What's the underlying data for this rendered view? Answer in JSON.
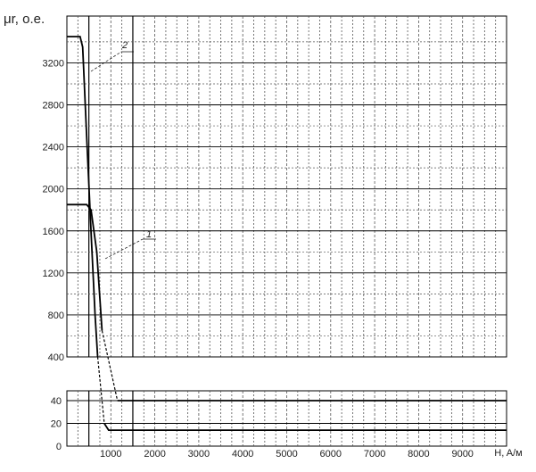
{
  "chart_data": {
    "type": "line",
    "title": "",
    "ylabel": "μr, o.e.",
    "xlabel": "H, A/м",
    "x_ticks": [
      "1000",
      "2000",
      "3000",
      "4000",
      "5000",
      "6000",
      "7000",
      "8000",
      "9000"
    ],
    "y_ticks_upper": [
      "400",
      "800",
      "1200",
      "1600",
      "2000",
      "2400",
      "2800",
      "3200"
    ],
    "y_ticks_lower": [
      "0",
      "20",
      "40"
    ],
    "series": [
      {
        "name": "1",
        "points": [
          [
            0,
            1850
          ],
          [
            450,
            1850
          ],
          [
            550,
            1800
          ],
          [
            680,
            1400
          ],
          [
            800,
            650
          ],
          [
            950,
            330
          ],
          [
            1080,
            70
          ],
          [
            1150,
            40
          ],
          [
            10000,
            40
          ]
        ]
      },
      {
        "name": "2",
        "points": [
          [
            0,
            3450
          ],
          [
            300,
            3450
          ],
          [
            360,
            3350
          ],
          [
            460,
            2400
          ],
          [
            560,
            1500
          ],
          [
            640,
            800
          ],
          [
            700,
            400
          ],
          [
            760,
            120
          ],
          [
            850,
            20
          ],
          [
            950,
            14
          ],
          [
            10000,
            14
          ]
        ]
      }
    ]
  }
}
